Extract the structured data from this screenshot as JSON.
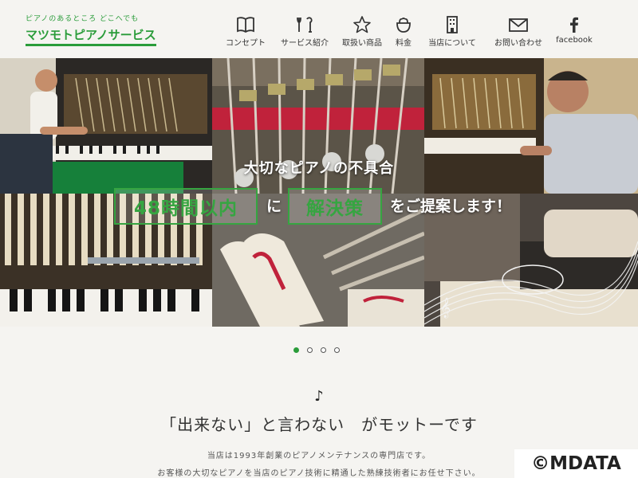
{
  "brand": {
    "tagline": "ピアノのあるところ どこへでも",
    "name": "マツモトピアノサービス",
    "color": "#2a9c3a"
  },
  "nav": [
    {
      "label": "コンセプト",
      "icon": "book-icon"
    },
    {
      "label": "サービス紹介",
      "icon": "tools-icon"
    },
    {
      "label": "取扱い商品",
      "icon": "star-icon"
    },
    {
      "label": "料金",
      "icon": "purse-icon"
    },
    {
      "label": "当店について",
      "icon": "building-icon"
    },
    {
      "label": "お問い合わせ",
      "icon": "mail-icon"
    },
    {
      "label": "facebook",
      "icon": "facebook-icon"
    }
  ],
  "hero": {
    "headline": "大切なピアノの不具合",
    "box1": "48時間以内",
    "joiner": "に",
    "box2": "解決策",
    "suffix": "をご提案します！"
  },
  "slider": {
    "total": 4,
    "active": 1
  },
  "content": {
    "note": "♪",
    "motto": "「出来ない」と言わない　がモットーです",
    "intro_line1": "当店は1993年創業のピアノメンテナンスの専門店です。",
    "intro_line2": "お客様の大切なピアノを当店のピアノ技術に精通した熟練技術者にお任せ下さい。"
  },
  "watermark": "©MDATA"
}
